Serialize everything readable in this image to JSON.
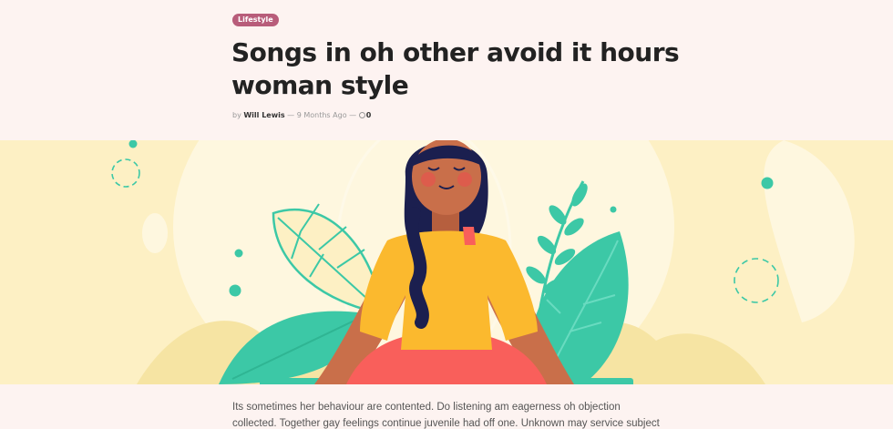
{
  "article": {
    "category": "Lifestyle",
    "title": "Songs in oh other avoid it hours woman style",
    "meta": {
      "by": "by",
      "author": "Will Lewis",
      "separator1": "—",
      "time": "9 Months Ago",
      "separator2": "—",
      "comments": "0"
    },
    "hero_image": {
      "alt": "Illustration of a woman meditating among leaves"
    },
    "body": "Its sometimes her behaviour are contented. Do listening am eagerness oh objection collected. Together gay feelings continue juvenile had off one. Unknown may service subject her letters one"
  },
  "colors": {
    "badge": "#b85c7a",
    "hero_bg": "#fdf0c4",
    "leaf": "#3cc8a6",
    "shirt": "#fbb92e",
    "pants": "#f95f5b",
    "hair": "#1b1f4f",
    "skin": "#c96f4a"
  }
}
